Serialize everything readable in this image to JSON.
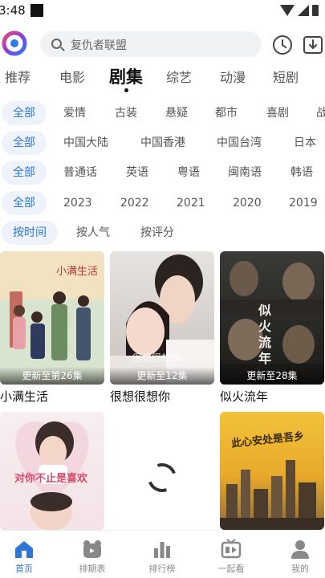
{
  "status": {
    "time": "3:48"
  },
  "search": {
    "placeholder": "复仇者联盟"
  },
  "category_tabs": [
    {
      "label": "推荐"
    },
    {
      "label": "电影"
    },
    {
      "label": "剧集"
    },
    {
      "label": "综艺"
    },
    {
      "label": "动漫"
    },
    {
      "label": "短剧"
    }
  ],
  "filters": {
    "genre": [
      "全部",
      "爱情",
      "古装",
      "悬疑",
      "都市",
      "喜剧",
      "战"
    ],
    "region": [
      "全部",
      "中国大陆",
      "中国香港",
      "中国台湾",
      "日本"
    ],
    "language": [
      "全部",
      "普通话",
      "英语",
      "粤语",
      "闽南语",
      "韩语"
    ],
    "year": [
      "全部",
      "2023",
      "2022",
      "2021",
      "2020",
      "2019"
    ],
    "sort": [
      "按时间",
      "按人气",
      "按评分"
    ]
  },
  "shows": [
    {
      "title": "小满生活",
      "badge": "更新至第26集",
      "poster_text": "小满生活"
    },
    {
      "title": "很想很想你",
      "badge": "更新至12集",
      "poster_text": "很想很想你"
    },
    {
      "title": "似火流年",
      "badge": "更新至28集",
      "poster_text": "似火流年"
    },
    {
      "title": "",
      "badge": "",
      "poster_text": "对你不止是喜欢"
    },
    {
      "title": "",
      "badge": "",
      "poster_text": "此心安处是吾乡"
    }
  ],
  "bottom_nav": [
    {
      "label": "首页",
      "icon": "home-icon"
    },
    {
      "label": "排期表",
      "icon": "schedule-icon"
    },
    {
      "label": "排行榜",
      "icon": "ranking-icon"
    },
    {
      "label": "一起看",
      "icon": "watch-together-icon"
    },
    {
      "label": "我的",
      "icon": "profile-icon"
    }
  ],
  "colors": {
    "accent": "#2f74d6",
    "chip_bg": "#eef3fb"
  }
}
